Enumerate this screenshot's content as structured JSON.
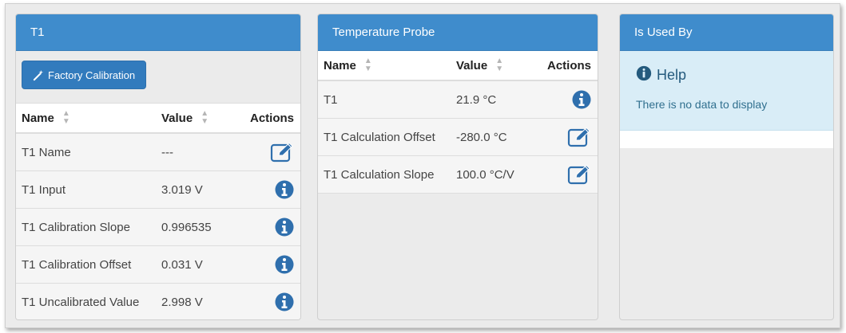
{
  "panel_t1": {
    "title": "T1",
    "factory_button": "Factory Calibration",
    "columns": {
      "name": "Name",
      "value": "Value",
      "actions": "Actions"
    },
    "rows": [
      {
        "name": "T1 Name",
        "value": "---",
        "action": "edit-icon"
      },
      {
        "name": "T1 Input",
        "value": "3.019 V",
        "action": "info-icon"
      },
      {
        "name": "T1 Calibration Slope",
        "value": "0.996535",
        "action": "info-icon"
      },
      {
        "name": "T1 Calibration Offset",
        "value": "0.031 V",
        "action": "info-icon"
      },
      {
        "name": "T1 Uncalibrated Value",
        "value": "2.998 V",
        "action": "info-icon"
      }
    ]
  },
  "panel_probe": {
    "title": "Temperature Probe",
    "columns": {
      "name": "Name",
      "value": "Value",
      "actions": "Actions"
    },
    "rows": [
      {
        "name": "T1",
        "value": "21.9 °C",
        "action": "info-icon"
      },
      {
        "name": "T1 Calculation Offset",
        "value": "-280.0 °C",
        "action": "edit-icon"
      },
      {
        "name": "T1 Calculation Slope",
        "value": "100.0 °C/V",
        "action": "edit-icon"
      }
    ]
  },
  "panel_used_by": {
    "title": "Is Used By",
    "help_title": "Help",
    "help_text": "There is no data to display"
  },
  "colors": {
    "heading": "#3f8ccc",
    "button": "#327bbd",
    "info_icon": "#2f6fad",
    "help_bg": "#d9edf7"
  }
}
